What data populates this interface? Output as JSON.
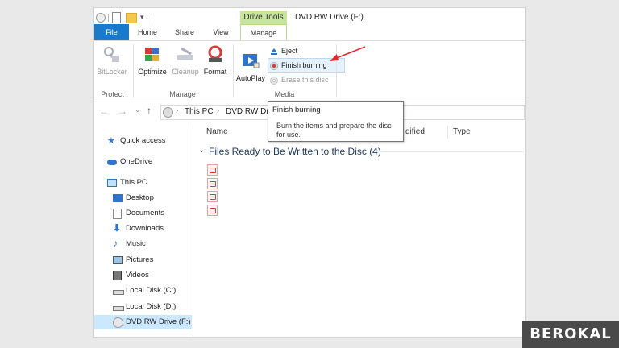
{
  "title_bar": {
    "context_tab": "Drive Tools",
    "window_title": "DVD RW Drive (F:)"
  },
  "tabs": {
    "file": "File",
    "home": "Home",
    "share": "Share",
    "view": "View",
    "manage": "Manage"
  },
  "ribbon": {
    "protect": {
      "bitlocker": "BitLocker",
      "group": "Protect"
    },
    "manage": {
      "optimize": "Optimize",
      "cleanup": "Cleanup",
      "format": "Format",
      "group": "Manage"
    },
    "media": {
      "autoplay": "AutoPlay",
      "eject": "Eject",
      "finish_burning": "Finish burning",
      "erase_disc": "Erase this disc",
      "group": "Media"
    }
  },
  "address": {
    "this_pc": "This PC",
    "drive": "DVD RW Dri"
  },
  "tooltip": {
    "title": "Finish burning",
    "body": "Burn the items and prepare the disc for use."
  },
  "nav": [
    {
      "label": "Quick access",
      "icon": "star-icon"
    },
    {
      "label": "OneDrive",
      "icon": "cloud-icon"
    },
    {
      "label": "This PC",
      "icon": "monitor-icon"
    },
    {
      "label": "Desktop",
      "icon": "desktop-icon"
    },
    {
      "label": "Documents",
      "icon": "documents-icon"
    },
    {
      "label": "Downloads",
      "icon": "download-icon"
    },
    {
      "label": "Music",
      "icon": "music-icon"
    },
    {
      "label": "Pictures",
      "icon": "pictures-icon"
    },
    {
      "label": "Videos",
      "icon": "videos-icon"
    },
    {
      "label": "Local Disk (C:)",
      "icon": "disk-icon"
    },
    {
      "label": "Local Disk (D:)",
      "icon": "disk-icon"
    },
    {
      "label": "DVD RW Drive (F:)",
      "icon": "dvd-icon"
    }
  ],
  "content": {
    "columns": {
      "name": "Name",
      "modified": "dified",
      "type": "Type"
    },
    "group_title": "Files Ready to Be Written to the Disc (4)"
  },
  "watermark": "BEROKAL",
  "colors": {
    "file_tab": "#1979ca",
    "drive_tools": "#c7e59b",
    "selected": "#cce8ff",
    "arrow": "#e0282e"
  }
}
